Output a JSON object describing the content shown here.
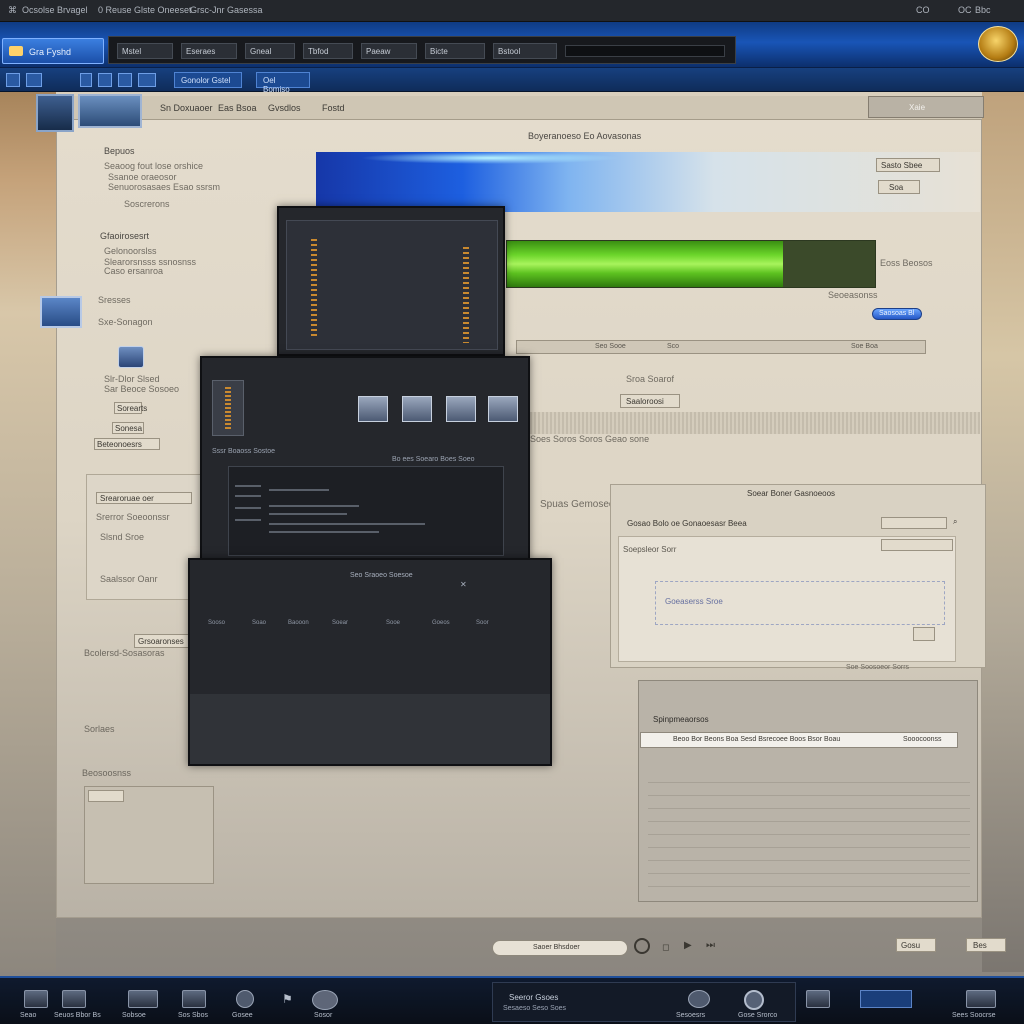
{
  "window": {
    "title": "Ocsolse Brvagel",
    "menu_items": [
      "0 Reuse Glste Oneeset",
      "Grsc-Jnr Gasessa"
    ],
    "right_controls": [
      "CO",
      "OC",
      "Bbc"
    ]
  },
  "header": {
    "logo_label": "Gra Fyshd",
    "toolbar_items": [
      "Mstel",
      "Eseraes",
      "Gneal",
      "Tbfod",
      "Paeaw",
      "Bicte",
      "Bstool"
    ]
  },
  "nav": {
    "tabs": [
      "Gonolor Gstel",
      "Oel Bomiso"
    ]
  },
  "breadcrumb": {
    "items": [
      "Sn Doxuaoer",
      "Eas Bsoa",
      "Gvsdlos",
      "Fostd"
    ],
    "right_button": "Xaie"
  },
  "content": {
    "heading": "Boyeranoeso Eo Aovasonas",
    "left_section_1_title": "Bepuos",
    "left_section_1_lines": [
      "Seaoog fout lose orshice",
      "Ssanoe oraeosor",
      "Senuorosasaes Esao ssrsm"
    ],
    "left_section_1_link": "Soscrerons",
    "left_section_2_title": "Gfaoirosesrt",
    "left_section_2_lines": [
      "Gelonoorslss",
      "Slearorsnsss ssnosnss",
      "Caso ersanroa"
    ],
    "left_section_3_title": "Sresses",
    "left_section_3_sub": "Sxe-Sonagon",
    "left_icon_caption": [
      "Slr-Dlor Slsed",
      "Sar Beoce Sosoeo"
    ],
    "left_buttons": [
      "Sorearts",
      "Sonesa",
      "Beteonoesrs"
    ],
    "left_list": [
      "Srearoruae oer",
      "Srerror Soeoonssr",
      "Slsnd Sroe",
      "Saalssor Oanr",
      "Grsoaronses",
      "Bcolersd-Sosasoras",
      "Sorlaes",
      "Beosoosnss"
    ],
    "right_buttons": [
      "Sasto Sbee",
      "Soa"
    ],
    "progress_side_labels": [
      "Eoss Beosos",
      "Seoeasonss"
    ],
    "progress": 0.75,
    "blue_button": "Saosoas Bl",
    "scrubber_labels": [
      "Seo Sooe",
      "Sco",
      "Soe Boa"
    ],
    "center_label_1": "Sroa Soarof",
    "center_button": "Saaloroosi",
    "center_caption": "Soes Soros Soros Geao sone",
    "mid_label": "Spuas Gemoseoi"
  },
  "dark_windows": {
    "win2_caption": "Sssr Boaoss Sostoe",
    "win2_header": "Bo ees Soearo Boes Soeo",
    "win3_header": "Seo Sraoeo Soesoe",
    "win3_columns": [
      "Sooso",
      "Soao",
      "Baooon",
      "Soear",
      "Sooe",
      "Goeos",
      "Soor"
    ]
  },
  "right_panel_1": {
    "title": "Soear Boner Gasnoeoos",
    "subtitle": "Gosao Bolo oe Gonaoesasr Beea",
    "section": "Soepsleor Sorr",
    "field_label": "Goeaserss Sroe",
    "footer": "Soe Soosoeor Sorrs"
  },
  "right_panel_2": {
    "title": "Spinpmeaorsos",
    "field_text": "Beoo Bor Beons Boa Sesd Bsrecoee Boos Bsor Boau",
    "field_right": "Sooocoonss"
  },
  "footer_controls": {
    "pill_label": "Saoer Bhsdoer",
    "right_buttons": [
      "Gosu",
      "Bes"
    ]
  },
  "taskbar": {
    "labels": [
      "Seao",
      "Seuos Bbor Bs",
      "Sobsoe",
      "Sos Sbos",
      "Gosee",
      "Sosor",
      "Seeror Gsoes",
      "Sesaeso Seso Soes",
      "Sesoesrs",
      "Gose Srorco",
      "Sees Soocrse"
    ]
  }
}
